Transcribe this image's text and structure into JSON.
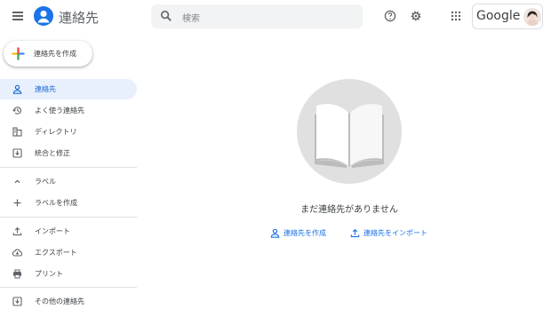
{
  "header": {
    "app_title": "連絡先",
    "search_placeholder": "検索",
    "brand": "Google"
  },
  "sidebar": {
    "create_label": "連絡先を作成",
    "items": [
      {
        "label": "連絡先",
        "icon": "person-icon",
        "active": true
      },
      {
        "label": "よく使う連絡先",
        "icon": "history-icon"
      },
      {
        "label": "ディレクトリ",
        "icon": "directory-icon"
      },
      {
        "label": "統合と修正",
        "icon": "merge-icon"
      },
      {
        "label": "ラベル",
        "icon": "chevron-up-icon"
      },
      {
        "label": "ラベルを作成",
        "icon": "plus-icon"
      },
      {
        "label": "インポート",
        "icon": "upload-icon"
      },
      {
        "label": "エクスポート",
        "icon": "cloud-download-icon"
      },
      {
        "label": "プリント",
        "icon": "print-icon"
      },
      {
        "label": "その他の連絡先",
        "icon": "other-contacts-icon"
      }
    ]
  },
  "main": {
    "empty_title": "まだ連絡先がありません",
    "actions": [
      {
        "label": "連絡先を作成",
        "icon": "person-icon"
      },
      {
        "label": "連絡先をインポート",
        "icon": "upload-icon"
      }
    ]
  },
  "colors": {
    "accent": "#1a73e8",
    "active_bg": "#e8f0fe",
    "icon_gray": "#5f6368"
  }
}
